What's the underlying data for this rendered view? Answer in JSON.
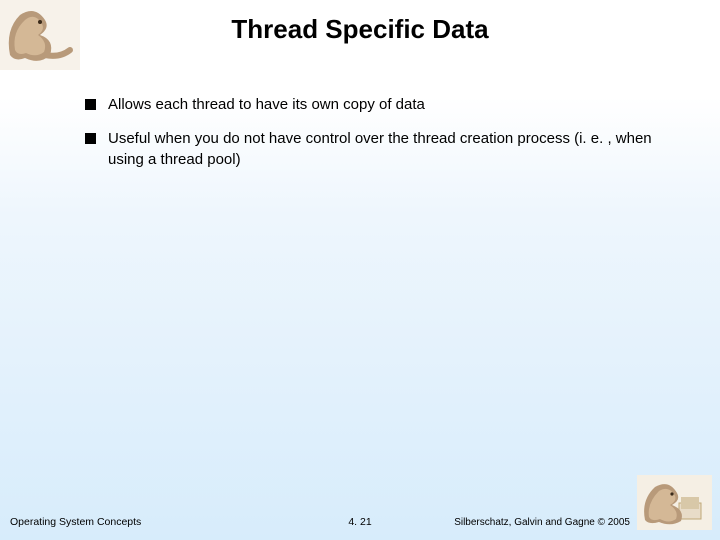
{
  "title": "Thread Specific Data",
  "bullets": [
    "Allows each thread to have its own copy of data",
    "Useful when you do not have control over the thread creation process (i. e. , when using a thread pool)"
  ],
  "footer": {
    "left": "Operating System Concepts",
    "center": "4. 21",
    "right": "Silberschatz, Galvin and Gagne © 2005"
  },
  "logos": {
    "top": "dinosaur-logo",
    "bottom": "dinosaur-logo-small"
  }
}
